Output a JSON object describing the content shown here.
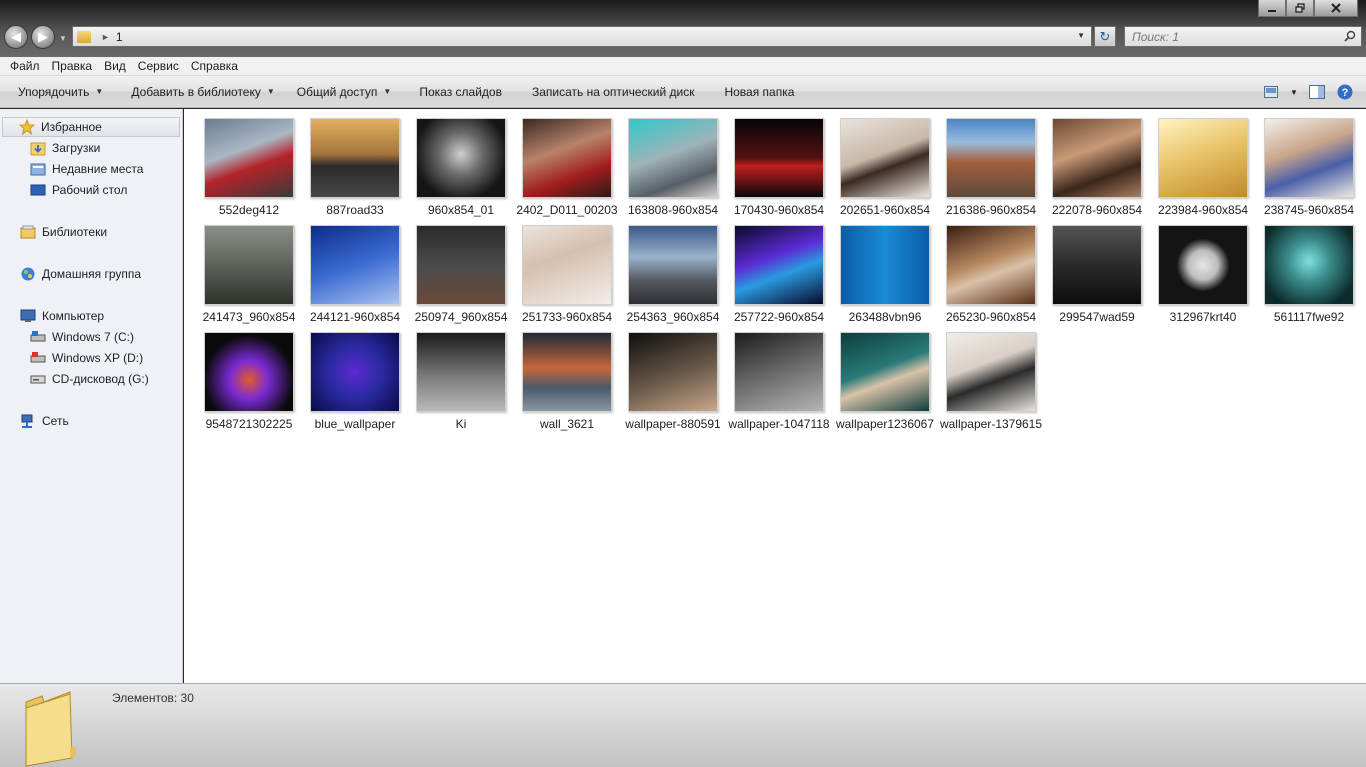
{
  "window": {
    "address_path": "1",
    "search_placeholder": "Поиск: 1"
  },
  "menu": [
    "Файл",
    "Правка",
    "Вид",
    "Сервис",
    "Справка"
  ],
  "toolbar": {
    "organize": "Упорядочить",
    "add_to_library": "Добавить в библиотеку",
    "share": "Общий доступ",
    "slideshow": "Показ слайдов",
    "burn": "Записать на оптический диск",
    "new_folder": "Новая папка"
  },
  "nav": {
    "favorites": "Избранное",
    "downloads": "Загрузки",
    "recent": "Недавние места",
    "desktop": "Рабочий стол",
    "libraries": "Библиотеки",
    "homegroup": "Домашняя группа",
    "computer": "Компьютер",
    "drive_c": "Windows 7 (C:)",
    "drive_d": "Windows XP (D:)",
    "drive_g": "CD-дисковод (G:)",
    "network": "Сеть"
  },
  "files": [
    {
      "name": "552deg412"
    },
    {
      "name": "887road33"
    },
    {
      "name": "960x854_01"
    },
    {
      "name": "2402_D011_00203"
    },
    {
      "name": "163808-960x854"
    },
    {
      "name": "170430-960x854"
    },
    {
      "name": "202651-960x854"
    },
    {
      "name": "216386-960x854"
    },
    {
      "name": "222078-960x854"
    },
    {
      "name": "223984-960x854"
    },
    {
      "name": "238745-960x854"
    },
    {
      "name": "241473_960x854"
    },
    {
      "name": "244121-960x854"
    },
    {
      "name": "250974_960x854"
    },
    {
      "name": "251733-960x854"
    },
    {
      "name": "254363_960x854"
    },
    {
      "name": "257722-960x854"
    },
    {
      "name": "263488vbn96"
    },
    {
      "name": "265230-960x854"
    },
    {
      "name": "299547wad59"
    },
    {
      "name": "312967krt40"
    },
    {
      "name": "561117fwe92"
    },
    {
      "name": "9548721302225"
    },
    {
      "name": "blue_wallpaper"
    },
    {
      "name": "Ki"
    },
    {
      "name": "wall_3621"
    },
    {
      "name": "wallpaper-880591"
    },
    {
      "name": "wallpaper-1047118"
    },
    {
      "name": "wallpaper1236067"
    },
    {
      "name": "wallpaper-1379615"
    }
  ],
  "status": {
    "items_count": "Элементов: 30"
  }
}
